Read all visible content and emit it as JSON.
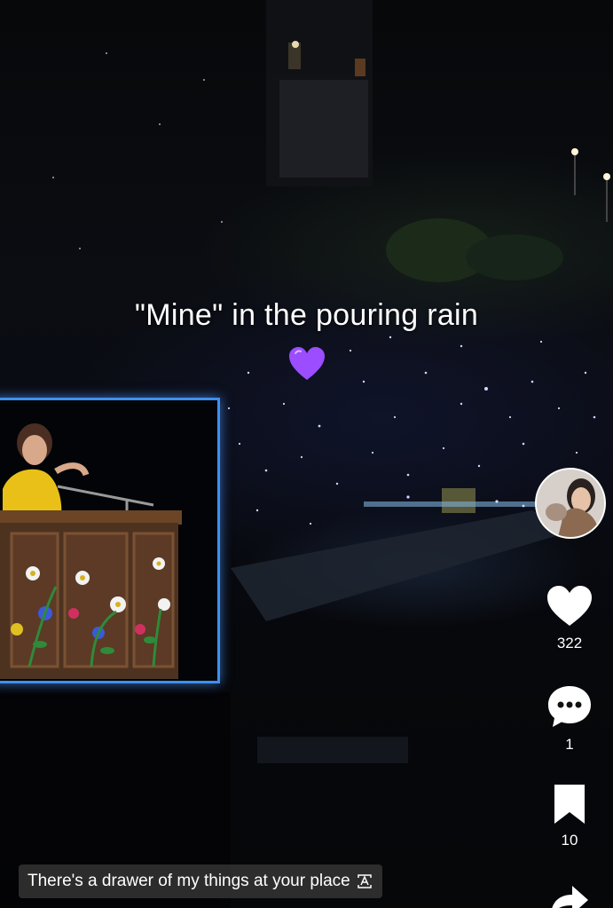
{
  "video": {
    "overlay_title": "\"Mine\" in the pouring rain",
    "overlay_emoji": "purple-heart-icon",
    "subtitle": "There's a drawer of my things at your place"
  },
  "actions": {
    "likes": "322",
    "comments": "1",
    "saves": "10"
  },
  "colors": {
    "screen_border": "#3f8ff0",
    "heart_purple": "#9b4dff",
    "subtitle_bg": "#464646"
  }
}
